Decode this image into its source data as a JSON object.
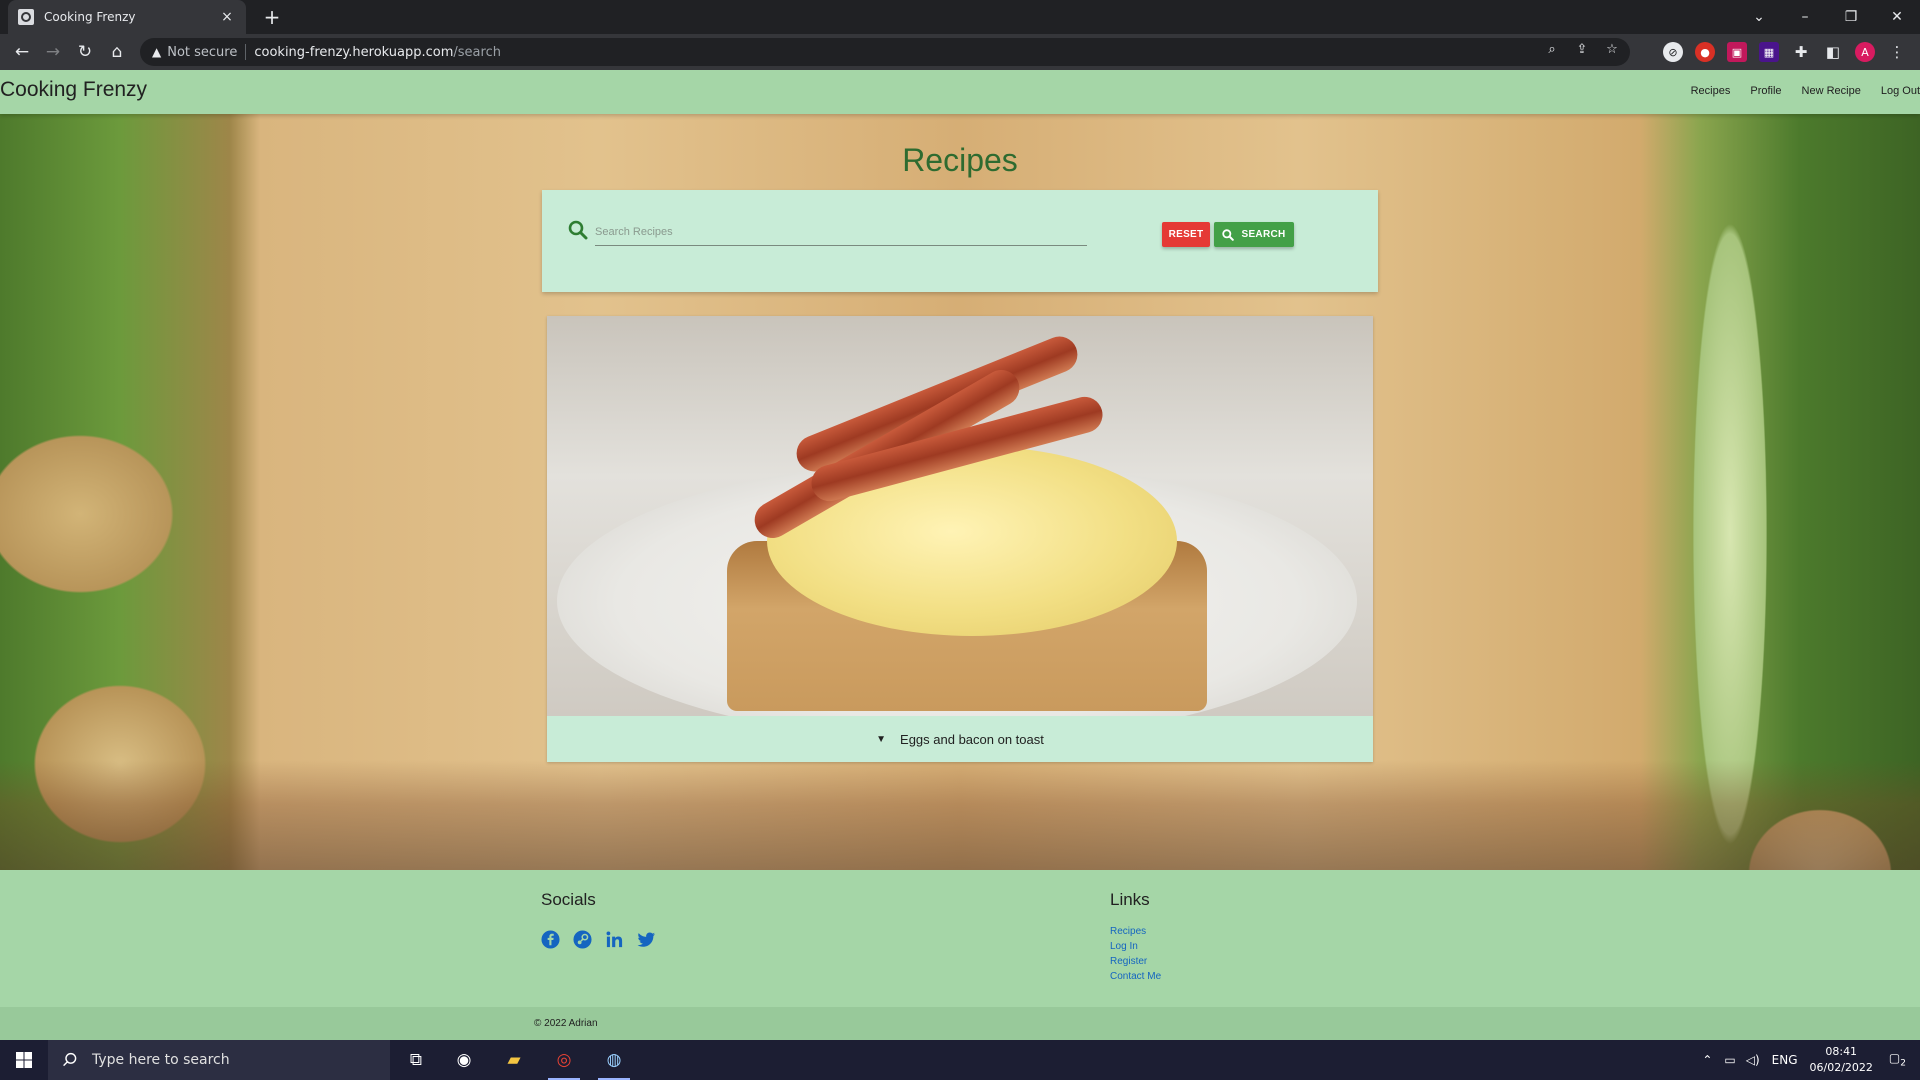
{
  "browser": {
    "tab_title": "Cooking Frenzy",
    "tab_close": "×",
    "new_tab": "+",
    "security_label": "Not secure",
    "url_host": "cooking-frenzy.herokuapp.com",
    "url_path": "/search",
    "profile_initial": "A"
  },
  "site": {
    "brand": "Cooking Frenzy",
    "nav": [
      "Recipes",
      "Profile",
      "New Recipe",
      "Log Out"
    ]
  },
  "main": {
    "title": "Recipes",
    "search_placeholder": "Search Recipes",
    "reset_label": "RESET",
    "search_label": "SEARCH",
    "recipe_title": "Eggs and bacon on toast"
  },
  "footer": {
    "socials_heading": "Socials",
    "social_icons": [
      "facebook-icon",
      "steam-icon",
      "linkedin-icon",
      "twitter-icon"
    ],
    "links_heading": "Links",
    "links": [
      "Recipes",
      "Log In",
      "Register",
      "Contact Me"
    ],
    "copyright": "© 2022 Adrian"
  },
  "taskbar": {
    "search_placeholder": "Type here to search",
    "language": "ENG",
    "time": "08:41",
    "date": "06/02/2022",
    "notifications": "2"
  },
  "colors": {
    "nav_green": "#a5d6a7",
    "card_mint": "#c8ecd7",
    "title_green": "#2e6b30",
    "reset_red": "#e53935",
    "search_green": "#43a047",
    "link_blue": "#1565c0"
  }
}
